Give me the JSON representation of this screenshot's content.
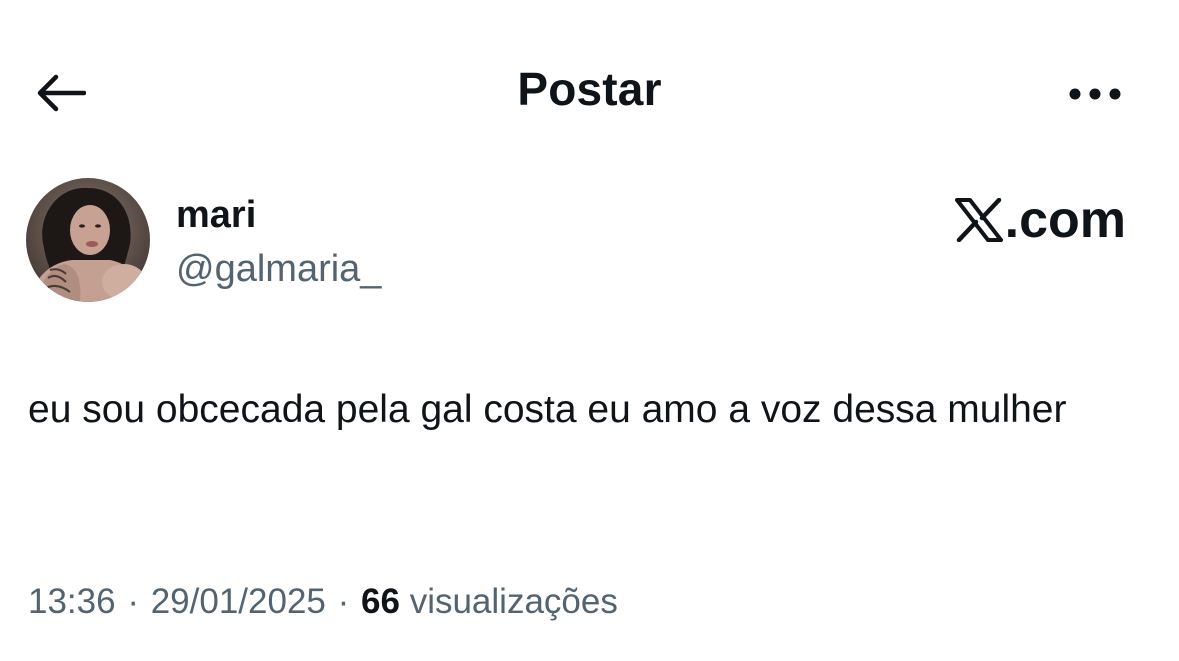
{
  "header": {
    "title": "Postar",
    "back_icon": "arrow-left-icon",
    "more_icon": "more-horizontal-icon"
  },
  "author": {
    "display_name": "mari",
    "handle": "@galmaria_",
    "avatar_icon": "avatar-photo"
  },
  "brand": {
    "logo_icon": "x-logo-icon",
    "domain": ".com"
  },
  "post": {
    "text": "eu sou obcecada pela gal costa eu amo a voz dessa mulher"
  },
  "meta": {
    "time": "13:36",
    "separator": "·",
    "date": "29/01/2025",
    "views_count": "66",
    "views_label": "visualizações"
  },
  "colors": {
    "text_primary": "#0f1419",
    "text_secondary": "#536471",
    "background": "#ffffff"
  }
}
